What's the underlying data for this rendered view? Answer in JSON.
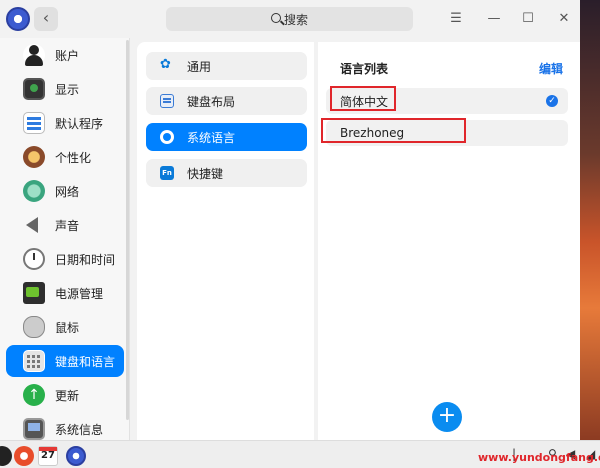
{
  "search": {
    "label": "搜索"
  },
  "sidebar": {
    "items": [
      {
        "label": "账户",
        "icon": "account-icon"
      },
      {
        "label": "显示",
        "icon": "display-icon"
      },
      {
        "label": "默认程序",
        "icon": "default-apps-icon"
      },
      {
        "label": "个性化",
        "icon": "personalization-icon"
      },
      {
        "label": "网络",
        "icon": "network-icon"
      },
      {
        "label": "声音",
        "icon": "sound-icon"
      },
      {
        "label": "日期和时间",
        "icon": "clock-icon"
      },
      {
        "label": "电源管理",
        "icon": "battery-icon"
      },
      {
        "label": "鼠标",
        "icon": "mouse-icon"
      },
      {
        "label": "键盘和语言",
        "icon": "keyboard-icon",
        "active": true
      },
      {
        "label": "更新",
        "icon": "update-icon"
      },
      {
        "label": "系统信息",
        "icon": "system-info-icon"
      }
    ]
  },
  "submenu": {
    "items": [
      {
        "label": "通用",
        "icon": "general-icon"
      },
      {
        "label": "键盘布局",
        "icon": "keyboard-layout-icon"
      },
      {
        "label": "系统语言",
        "icon": "language-icon",
        "active": true
      },
      {
        "label": "快捷键",
        "icon": "shortcut-icon",
        "icon_text": "Fn"
      }
    ]
  },
  "language_panel": {
    "title": "语言列表",
    "edit_label": "编辑",
    "languages": [
      {
        "label": "简体中文",
        "checked": true
      },
      {
        "label": "Brezhoneg",
        "checked": false
      }
    ],
    "add_label": "+"
  },
  "taskbar": {
    "calendar_day": "27"
  },
  "watermark": "www.yundongfang.com",
  "colors": {
    "accent": "#0081ff",
    "highlight_box": "#e0262b"
  }
}
